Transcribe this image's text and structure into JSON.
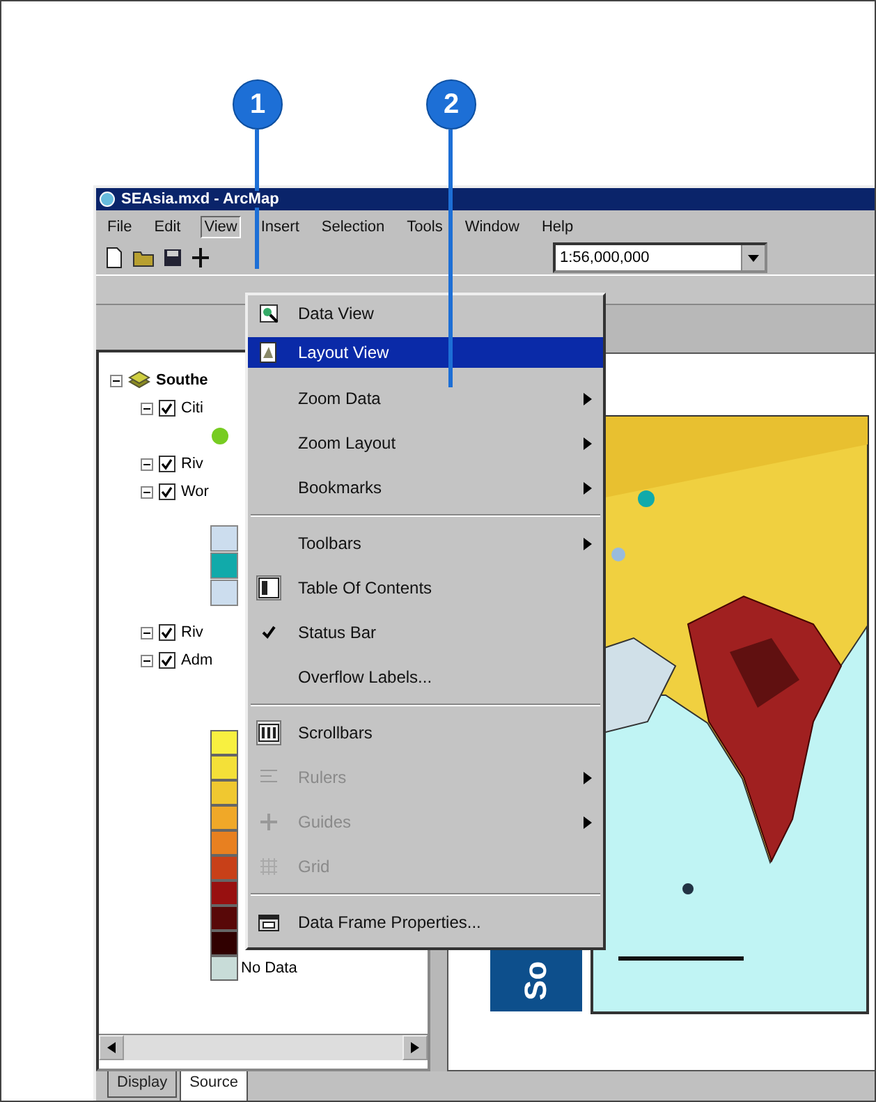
{
  "callouts": [
    {
      "label": "1"
    },
    {
      "label": "2"
    }
  ],
  "window": {
    "title": "SEAsia.mxd - ArcMap"
  },
  "menu_bar": [
    {
      "label": "File",
      "selected": false
    },
    {
      "label": "Edit",
      "selected": false
    },
    {
      "label": "View",
      "selected": true
    },
    {
      "label": "Insert",
      "selected": false
    },
    {
      "label": "Selection",
      "selected": false
    },
    {
      "label": "Tools",
      "selected": false
    },
    {
      "label": "Window",
      "selected": false
    },
    {
      "label": "Help",
      "selected": false
    }
  ],
  "toolbar": {
    "scale": "1:56,000,000"
  },
  "table_of_contents": {
    "data_frame": "Southe",
    "layers": [
      {
        "label": "Citi",
        "checked": true
      },
      {
        "label": "Riv",
        "checked": true
      },
      {
        "label": "Wor",
        "checked": true
      },
      {
        "label": "Riv",
        "checked": true
      },
      {
        "label": "Adm",
        "checked": true
      }
    ],
    "legend": [
      {
        "color": "#f8f040"
      },
      {
        "color": "#f4e038"
      },
      {
        "color": "#f0c830"
      },
      {
        "color": "#f0a828"
      },
      {
        "color": "#e88020"
      },
      {
        "color": "#c84018"
      },
      {
        "color": "#981010"
      },
      {
        "color": "#580808"
      },
      {
        "color": "#300000"
      },
      {
        "color": "#c8dcd8",
        "label": "No Data"
      }
    ]
  },
  "view_menu": [
    {
      "kind": "item",
      "label": "Data View",
      "selected": false,
      "checked": false,
      "disabled": false,
      "submenu": false
    },
    {
      "kind": "item",
      "label": "Layout View",
      "selected": true,
      "checked": false,
      "disabled": false,
      "submenu": false
    },
    {
      "kind": "item",
      "label": "Zoom Data",
      "selected": false,
      "checked": false,
      "disabled": false,
      "submenu": true
    },
    {
      "kind": "item",
      "label": "Zoom Layout",
      "selected": false,
      "checked": false,
      "disabled": false,
      "submenu": true
    },
    {
      "kind": "item",
      "label": "Bookmarks",
      "selected": false,
      "checked": false,
      "disabled": false,
      "submenu": true
    },
    {
      "kind": "separator"
    },
    {
      "kind": "item",
      "label": "Toolbars",
      "selected": false,
      "checked": false,
      "disabled": false,
      "submenu": true
    },
    {
      "kind": "item",
      "label": "Table Of Contents",
      "selected": false,
      "checked": true,
      "disabled": false,
      "submenu": false
    },
    {
      "kind": "item",
      "label": "Status Bar",
      "selected": false,
      "checked": true,
      "disabled": false,
      "submenu": false
    },
    {
      "kind": "item",
      "label": "Overflow Labels...",
      "selected": false,
      "checked": false,
      "disabled": false,
      "submenu": false
    },
    {
      "kind": "separator"
    },
    {
      "kind": "item",
      "label": "Scrollbars",
      "selected": false,
      "checked": true,
      "disabled": false,
      "submenu": false
    },
    {
      "kind": "item",
      "label": "Rulers",
      "selected": false,
      "checked": false,
      "disabled": true,
      "submenu": true
    },
    {
      "kind": "item",
      "label": "Guides",
      "selected": false,
      "checked": false,
      "disabled": true,
      "submenu": true
    },
    {
      "kind": "item",
      "label": "Grid",
      "selected": false,
      "checked": false,
      "disabled": true,
      "submenu": false
    },
    {
      "kind": "separator"
    },
    {
      "kind": "item",
      "label": "Data Frame Properties...",
      "selected": false,
      "checked": false,
      "disabled": false,
      "submenu": false
    }
  ],
  "map": {
    "title": "So"
  },
  "tabs": [
    {
      "label": "Display",
      "selected": false
    },
    {
      "label": "Source",
      "selected": true
    }
  ]
}
